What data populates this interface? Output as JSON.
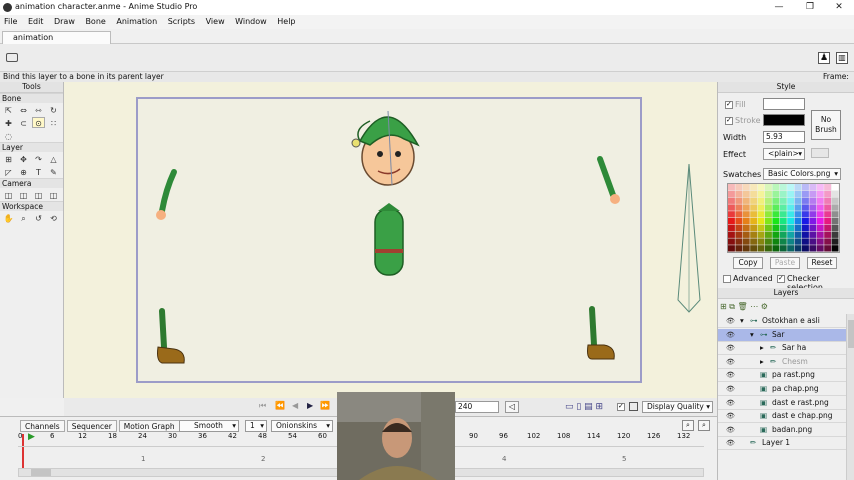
{
  "window": {
    "title": "animation character.anme - Anime Studio Pro",
    "controls": [
      "minimize",
      "maximize",
      "close"
    ]
  },
  "menu": [
    "File",
    "Edit",
    "Draw",
    "Bone",
    "Animation",
    "Scripts",
    "View",
    "Window",
    "Help"
  ],
  "doc_tab": "animation character.anme",
  "status": {
    "hint": "Bind this layer to a bone in its parent layer",
    "frame": "Frame: 0"
  },
  "tools": {
    "title": "Tools",
    "groups": [
      {
        "label": "Bone",
        "rows": [
          [
            "bone-select",
            "bone-translate",
            "bone-scale",
            "bone-rotate"
          ],
          [
            "bone-add",
            "bone-reparent",
            "bind-layer",
            "bone-offset"
          ],
          [
            "bone-strength"
          ]
        ]
      },
      {
        "label": "Layer",
        "rows": [
          [
            "layer-transform",
            "layer-translate",
            "layer-rotate",
            "layer-switch"
          ],
          [
            "layer-bend",
            "layer-bind",
            "text-tool",
            "eyedropper"
          ]
        ]
      },
      {
        "label": "Camera",
        "rows": [
          [
            "camera-track",
            "camera-zoom",
            "camera-roll",
            "camera-pan"
          ]
        ]
      },
      {
        "label": "Workspace",
        "rows": [
          [
            "hand-pan",
            "zoom",
            "rotate-workspace",
            "orbit"
          ]
        ]
      }
    ]
  },
  "playback": {
    "end_frame": "240",
    "display_quality": "Display Quality"
  },
  "timeline": {
    "tabs": [
      "Channels",
      "Sequencer",
      "Motion Graph"
    ],
    "interp": "Smooth",
    "interp_count": "1",
    "onionskins": "Onionskins",
    "ticks": [
      "0",
      "6",
      "12",
      "18",
      "24",
      "30",
      "36",
      "42",
      "48",
      "54",
      "60",
      "90",
      "96",
      "102",
      "108",
      "114",
      "120",
      "126",
      "132"
    ],
    "seconds": [
      "1",
      "2",
      "4",
      "5"
    ]
  },
  "style": {
    "title": "Style",
    "fill_label": "Fill",
    "stroke_label": "Stroke",
    "width_label": "Width",
    "width_value": "5.93",
    "no_brush": "No Brush",
    "effect_label": "Effect",
    "effect_value": "<plain>",
    "swatches_label": "Swatches",
    "swatches_value": "Basic Colors.png",
    "copy": "Copy",
    "paste": "Paste",
    "reset": "Reset",
    "advanced": "Advanced",
    "checker": "Checker selection",
    "fill_color": "#ffffff",
    "stroke_color": "#000000"
  },
  "layers": {
    "title": "Layers",
    "items": [
      {
        "name": "Ostokhan e asli",
        "indent": 0,
        "icon": "bone-layer-icon"
      },
      {
        "name": "Sar",
        "indent": 1,
        "icon": "bone-layer-icon",
        "selected": true
      },
      {
        "name": "Sar ha",
        "indent": 2,
        "icon": "vector-layer-icon"
      },
      {
        "name": "Chesm",
        "indent": 2,
        "icon": "vector-layer-icon",
        "dim": true
      },
      {
        "name": "pa rast.png",
        "indent": 1,
        "icon": "image-layer-icon"
      },
      {
        "name": "pa chap.png",
        "indent": 1,
        "icon": "image-layer-icon"
      },
      {
        "name": "dast e rast.png",
        "indent": 1,
        "icon": "image-layer-icon"
      },
      {
        "name": "dast e chap.png",
        "indent": 1,
        "icon": "image-layer-icon"
      },
      {
        "name": "badan.png",
        "indent": 1,
        "icon": "image-layer-icon"
      },
      {
        "name": "Layer 1",
        "indent": 0,
        "icon": "vector-layer-icon"
      }
    ]
  }
}
